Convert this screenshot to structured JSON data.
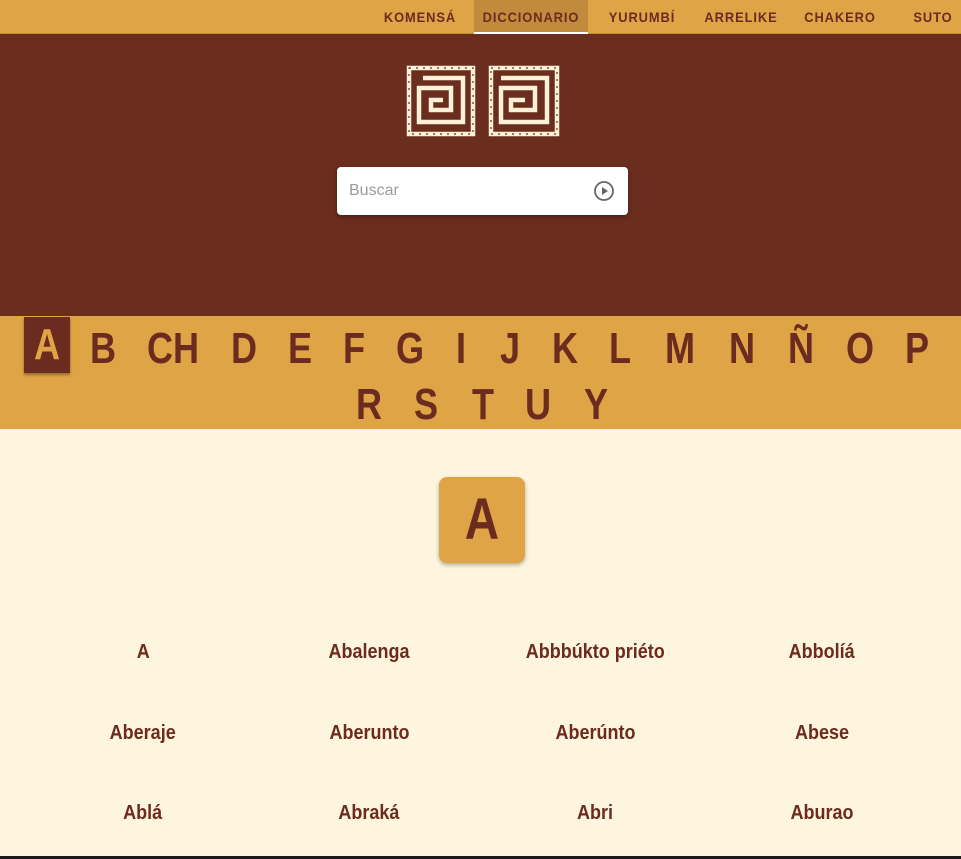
{
  "nav": {
    "items": [
      "KOMENSÁ",
      "DICCIONARIO",
      "YURUMBÍ",
      "ARRELIKE",
      "CHAKERO",
      "SUTO"
    ],
    "active": "DICCIONARIO"
  },
  "hero": {
    "logo_icon": "spiral-squares-logo-icon",
    "search": {
      "placeholder": "Buscar",
      "value": "",
      "submit_icon": "play-circle-icon"
    }
  },
  "alphabet": {
    "letters": [
      "A",
      "B",
      "CH",
      "D",
      "E",
      "F",
      "G",
      "I",
      "J",
      "K",
      "L",
      "M",
      "N",
      "Ñ",
      "O",
      "P",
      "R",
      "S",
      "T",
      "U",
      "Y"
    ],
    "active": "A"
  },
  "section": {
    "letter": "A",
    "words": [
      "A",
      "Abalenga",
      "Abbbúkto priéto",
      "Abbolíá",
      "Aberaje",
      "Aberunto",
      "Aberúnto",
      "Abese",
      "Ablá",
      "Abraká",
      "Abri",
      "Aburao"
    ]
  },
  "colors": {
    "primary": "#6b2b1e",
    "accent": "#dfa446",
    "background": "#fdf5dd"
  }
}
